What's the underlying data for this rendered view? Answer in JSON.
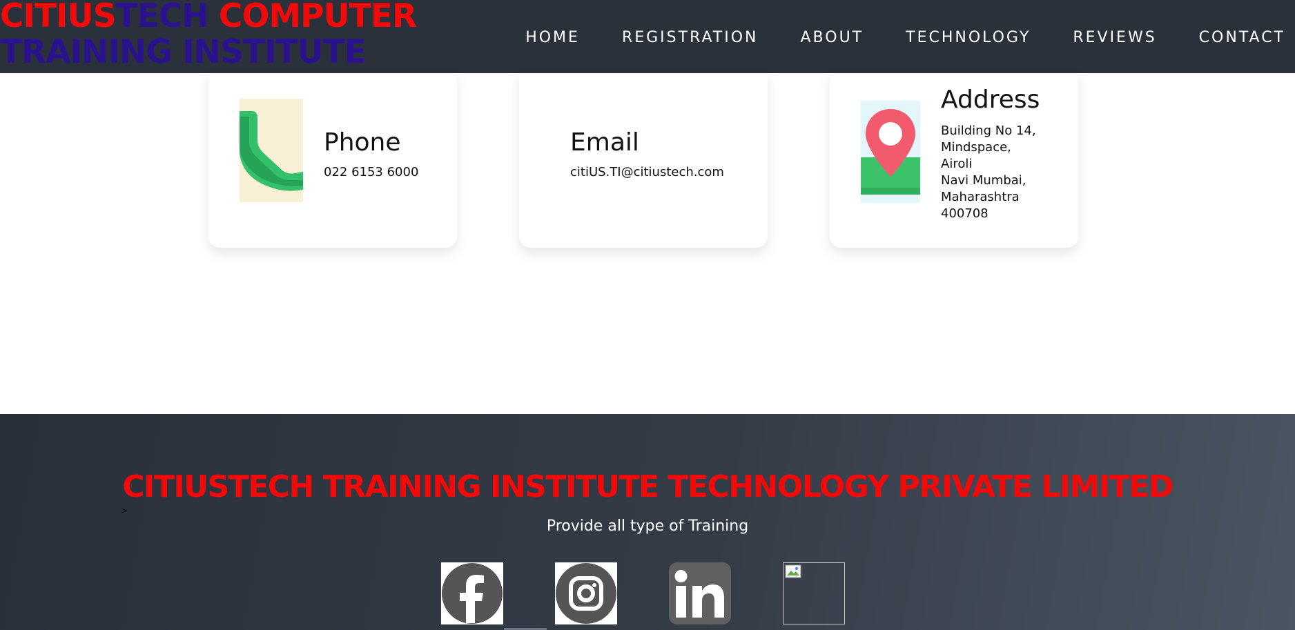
{
  "header": {
    "logo": {
      "line1_red_a": "CITIUS",
      "line1_blue": "TECH",
      "line1_red_b": "COMPUTER",
      "line2_blue": "TRAINING INSTITUTE"
    },
    "nav": [
      "HOME",
      "REGISTRATION",
      "ABOUT",
      "TECHNOLOGY",
      "REVIEWS",
      "CONTACT"
    ]
  },
  "contact": {
    "phone": {
      "title": "Phone",
      "value": "022 6153 6000",
      "icon": "phone-icon"
    },
    "email": {
      "title": "Email",
      "value": "citiUS.TI@citiustech.com"
    },
    "address": {
      "title": "Address",
      "lines": [
        "Building No 14,",
        "Mindspace,",
        "Airoli",
        "Navi Mumbai,",
        "Maharashtra",
        "400708"
      ],
      "icon": "location-pin-icon"
    }
  },
  "footer": {
    "title": "CITIUSTECH TRAINING INSTITUTE TECHNOLOGY PRIVATE LIMITED",
    "mark": ">",
    "tagline": "Provide all type of Training",
    "social": [
      "facebook-icon",
      "instagram-icon",
      "linkedin-icon",
      "broken-image-icon"
    ]
  },
  "colors": {
    "header_bg": "#2b313b",
    "brand_red": "#f00a0a",
    "brand_blue": "#2a128f",
    "footer_bg": "#343c47"
  }
}
